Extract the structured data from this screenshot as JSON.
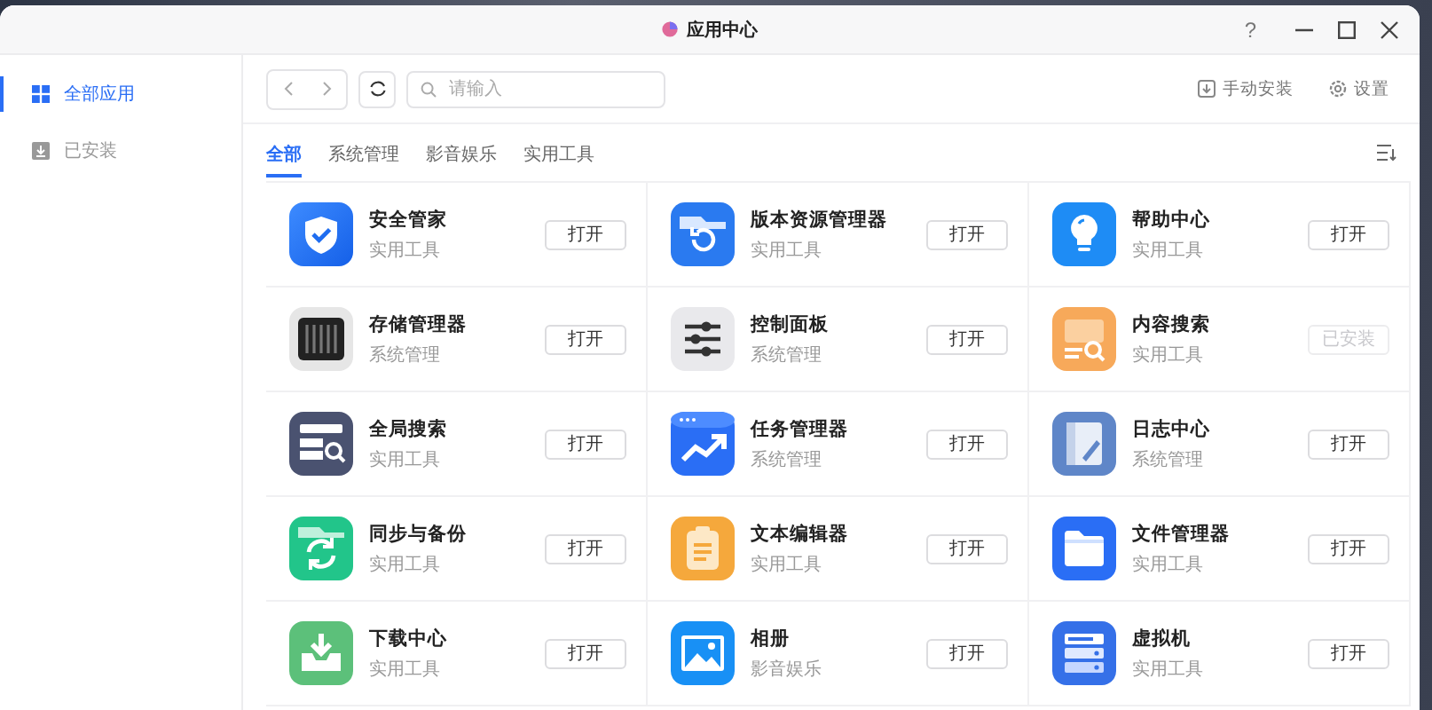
{
  "window": {
    "title": "应用中心",
    "help": "?"
  },
  "sidebar": {
    "items": [
      {
        "label": "全部应用",
        "selected": true
      },
      {
        "label": "已安装",
        "selected": false
      }
    ]
  },
  "toolbar": {
    "search": {
      "placeholder": "请输入"
    },
    "manual_install": "手动安装",
    "settings": "设置"
  },
  "tabs": [
    {
      "label": "全部",
      "selected": true
    },
    {
      "label": "系统管理",
      "selected": false
    },
    {
      "label": "影音娱乐",
      "selected": false
    },
    {
      "label": "实用工具",
      "selected": false
    }
  ],
  "apps": [
    {
      "name": "安全管家",
      "category": "实用工具",
      "button": {
        "label": "打开",
        "disabled": false
      }
    },
    {
      "name": "版本资源管理器",
      "category": "实用工具",
      "button": {
        "label": "打开",
        "disabled": false
      }
    },
    {
      "name": "帮助中心",
      "category": "实用工具",
      "button": {
        "label": "打开",
        "disabled": false
      }
    },
    {
      "name": "存储管理器",
      "category": "系统管理",
      "button": {
        "label": "打开",
        "disabled": false
      }
    },
    {
      "name": "控制面板",
      "category": "系统管理",
      "button": {
        "label": "打开",
        "disabled": false
      }
    },
    {
      "name": "内容搜索",
      "category": "实用工具",
      "button": {
        "label": "已安装",
        "disabled": true
      }
    },
    {
      "name": "全局搜索",
      "category": "实用工具",
      "button": {
        "label": "打开",
        "disabled": false
      }
    },
    {
      "name": "任务管理器",
      "category": "系统管理",
      "button": {
        "label": "打开",
        "disabled": false
      }
    },
    {
      "name": "日志中心",
      "category": "系统管理",
      "button": {
        "label": "打开",
        "disabled": false
      }
    },
    {
      "name": "同步与备份",
      "category": "实用工具",
      "button": {
        "label": "打开",
        "disabled": false
      }
    },
    {
      "name": "文本编辑器",
      "category": "实用工具",
      "button": {
        "label": "打开",
        "disabled": false
      }
    },
    {
      "name": "文件管理器",
      "category": "实用工具",
      "button": {
        "label": "打开",
        "disabled": false
      }
    },
    {
      "name": "下载中心",
      "category": "实用工具",
      "button": {
        "label": "打开",
        "disabled": false
      }
    },
    {
      "name": "相册",
      "category": "影音娱乐",
      "button": {
        "label": "打开",
        "disabled": false
      }
    },
    {
      "name": "虚拟机",
      "category": "实用工具",
      "button": {
        "label": "打开",
        "disabled": false
      }
    }
  ]
}
